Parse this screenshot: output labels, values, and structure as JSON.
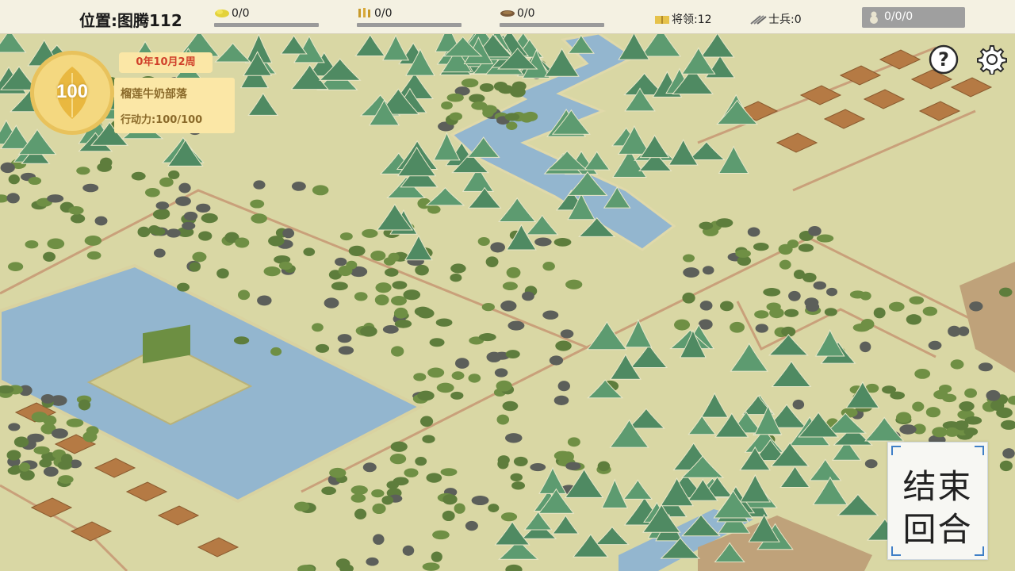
{
  "top_bar": {
    "location_label": "位置:图腾112",
    "resources": [
      {
        "icon": "grain-icon",
        "value": "0/0",
        "color": "#e3d23a"
      },
      {
        "icon": "wood-icon",
        "value": "0/0",
        "color": "#c79a2a"
      },
      {
        "icon": "meat-icon",
        "value": "0/0",
        "color": "#7a5a3a"
      }
    ],
    "generals": "将领:12",
    "soldiers": "士兵:0",
    "population": "0/0/0"
  },
  "tribe": {
    "emblem_value": "100",
    "date": "0年10月2周",
    "name": "榴莲牛奶部落",
    "action_points": "行动力:100/100"
  },
  "buttons": {
    "help_icon": "question-icon",
    "settings_icon": "gear-icon",
    "end_turn_line1": "结束",
    "end_turn_line2": "回合"
  },
  "colors": {
    "grass": "#d9d7a4",
    "water": "#92b4cc",
    "forest": "#5e7d3c",
    "mountain": "#4f8a62",
    "road": "#c9a27a",
    "field": "#a86a3a"
  }
}
